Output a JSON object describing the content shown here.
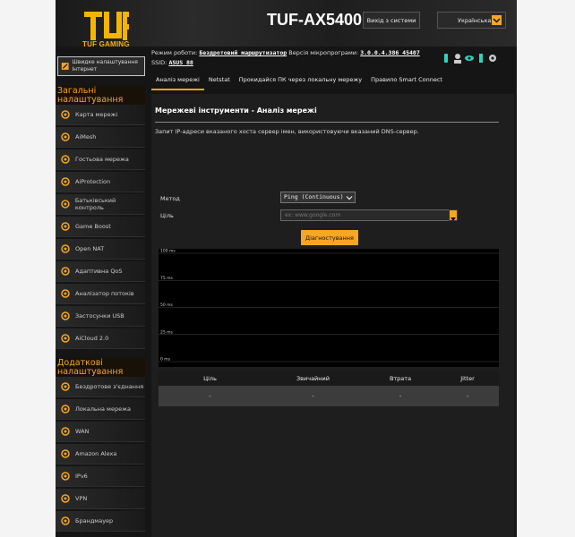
{
  "header": {
    "logo_text": "TUF GAMING",
    "model": "TUF-AX5400",
    "logout_label": "Вихід з системи",
    "language": "Українська"
  },
  "info": {
    "mode_label": "Режим роботи:",
    "mode_value": "Бездротовий маршрутизатор",
    "fw_label": "Версія мікропрограми:",
    "fw_value": "3.0.0.4.386_45407",
    "ssid_label": "SSID:",
    "ssid_value": "ASUS_88"
  },
  "sidebar": {
    "quick_setup": "Швидке налаштування Інтернет",
    "general_header": "Загальні налаштування",
    "general_items": [
      {
        "label": "Карта мережі",
        "icon": "globe-icon"
      },
      {
        "label": "AiMesh",
        "icon": "mesh-icon"
      },
      {
        "label": "Гостьова мережа",
        "icon": "guest-icon"
      },
      {
        "label": "AiProtection",
        "icon": "shield-icon"
      },
      {
        "label": "Батьківський контроль",
        "icon": "parental-icon"
      },
      {
        "label": "Game Boost",
        "icon": "rocket-icon"
      },
      {
        "label": "Open NAT",
        "icon": "gamepad-icon"
      },
      {
        "label": "Адаптивна QoS",
        "icon": "gauge-icon"
      },
      {
        "label": "Аналізатор потоків",
        "icon": "chart-icon"
      },
      {
        "label": "Застосунки USB",
        "icon": "usb-icon"
      },
      {
        "label": "AiCloud 2.0",
        "icon": "cloud-icon"
      }
    ],
    "advanced_header": "Додаткові налаштування",
    "advanced_items": [
      {
        "label": "Бездротове з'єднання",
        "icon": "wifi-icon"
      },
      {
        "label": "Локальна мережа",
        "icon": "home-icon"
      },
      {
        "label": "WAN",
        "icon": "globe-icon"
      },
      {
        "label": "Amazon Alexa",
        "icon": "alexa-icon"
      },
      {
        "label": "IPv6",
        "icon": "ipv6-icon"
      },
      {
        "label": "VPN",
        "icon": "vpn-icon"
      },
      {
        "label": "Брандмауер",
        "icon": "firewall-icon"
      }
    ]
  },
  "tabs": [
    "Аналіз мережі",
    "Netstat",
    "Прокидайся ПК через локальну мережу",
    "Правило Smart Connect"
  ],
  "panel": {
    "title": "Мережеві інструменти - Аналіз мережі",
    "description": "Запит IP-адреси вказаного хоста сервер імен, використовуючи вказаний DNS-сервер.",
    "method_label": "Метод",
    "method_value": "Ping (Continuous)",
    "target_label": "Ціль",
    "target_placeholder": "ex: www.google.com",
    "diagnose_label": "Діагностування"
  },
  "chart_data": {
    "type": "line",
    "y_ticks": [
      "100 ms",
      "75 ms",
      "50 ms",
      "25 ms",
      "0 ms"
    ],
    "ylim": [
      0,
      100
    ],
    "series": []
  },
  "stats": {
    "headers": [
      "Ціль",
      "Звичайний",
      "Втрата",
      "Jitter"
    ],
    "row": [
      "-",
      "-",
      "-",
      "-"
    ]
  },
  "colors": {
    "accent": "#f5a623",
    "background": "#151515"
  }
}
